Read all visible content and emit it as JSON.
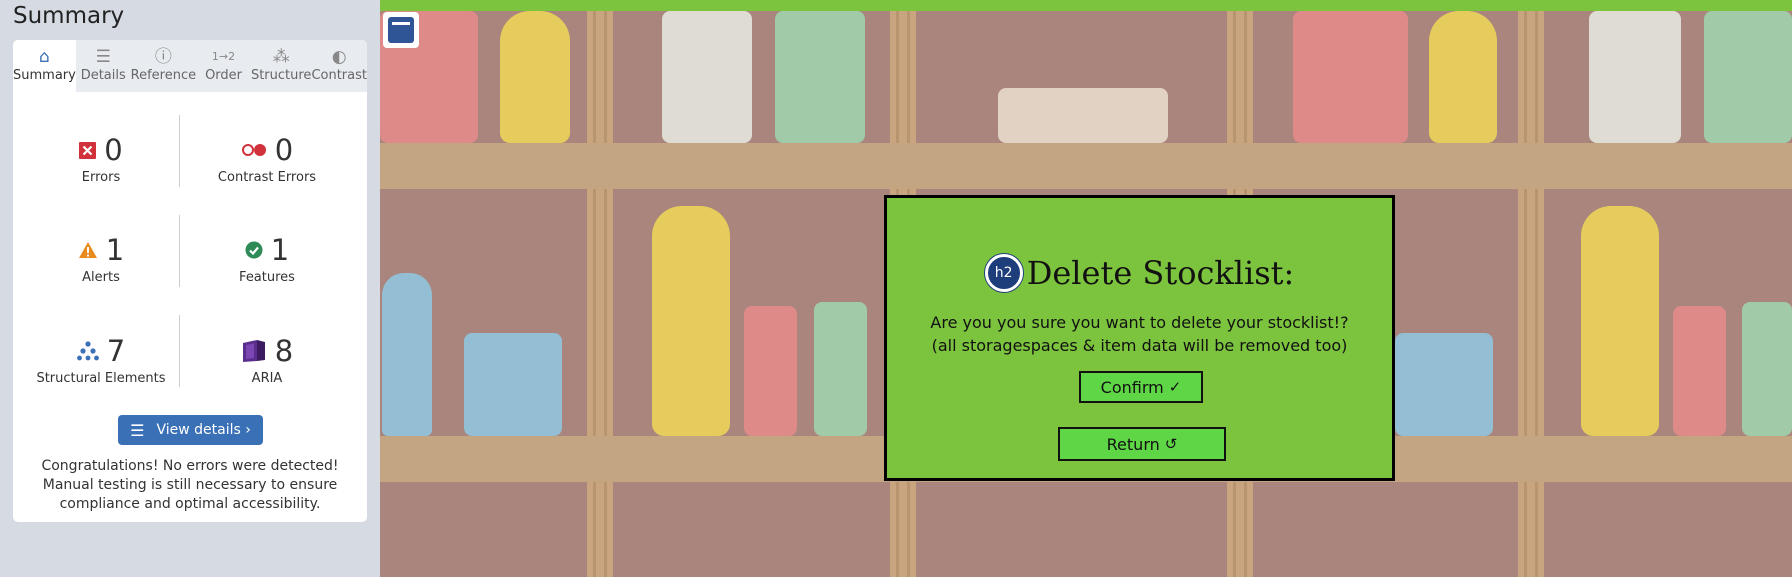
{
  "sidebar": {
    "title": "Summary",
    "tabs": [
      {
        "label": "Summary",
        "icon": "home-icon"
      },
      {
        "label": "Details",
        "icon": "list-icon"
      },
      {
        "label": "Reference",
        "icon": "info-icon"
      },
      {
        "label": "Order",
        "icon": "order-icon"
      },
      {
        "label": "Structure",
        "icon": "structure-icon"
      },
      {
        "label": "Contrast",
        "icon": "contrast-icon"
      }
    ],
    "stats": {
      "errors": {
        "count": "0",
        "label": "Errors"
      },
      "contrast_errors": {
        "count": "0",
        "label": "Contrast Errors"
      },
      "alerts": {
        "count": "1",
        "label": "Alerts"
      },
      "features": {
        "count": "1",
        "label": "Features"
      },
      "structural": {
        "count": "7",
        "label": "Structural Elements"
      },
      "aria": {
        "count": "8",
        "label": "ARIA"
      }
    },
    "view_details_label": "View details ›",
    "message": "Congratulations! No errors were detected! Manual testing is still necessary to ensure compliance and optimal accessibility."
  },
  "dialog": {
    "badge": "h2",
    "title": "Delete Stocklist:",
    "line1": "Are you you sure you want to delete your stocklist!?",
    "line2": "(all storagespaces & item data will be removed too)",
    "confirm_label": "Confirm",
    "return_label": "Return"
  },
  "colors": {
    "accent_green": "#7cc33e",
    "button_green": "#5ed646",
    "wave_blue": "#3a70b6",
    "shelf_brown": "#a9857d"
  }
}
